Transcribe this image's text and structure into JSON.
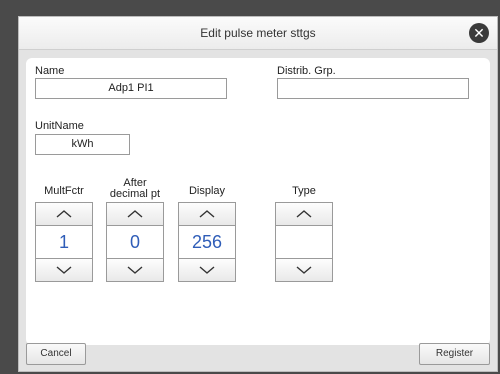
{
  "dialog": {
    "title": "Edit pulse meter sttgs",
    "close_icon": "close-icon"
  },
  "fields": {
    "name_label": "Name",
    "name_value": "Adp1 PI1",
    "distrib_label": "Distrib. Grp.",
    "distrib_value": "",
    "unitname_label": "UnitName",
    "unitname_value": "kWh"
  },
  "spinners": [
    {
      "label": "MultFctr",
      "value": "1"
    },
    {
      "label": "After\ndecimal pt",
      "value": "0"
    },
    {
      "label": "Display",
      "value": "256"
    },
    {
      "label": "Type",
      "value": ""
    }
  ],
  "footer": {
    "cancel_label": "Cancel",
    "register_label": "Register"
  },
  "colors": {
    "value_blue": "#2f5db8",
    "close_bg": "#3a3a3a"
  }
}
